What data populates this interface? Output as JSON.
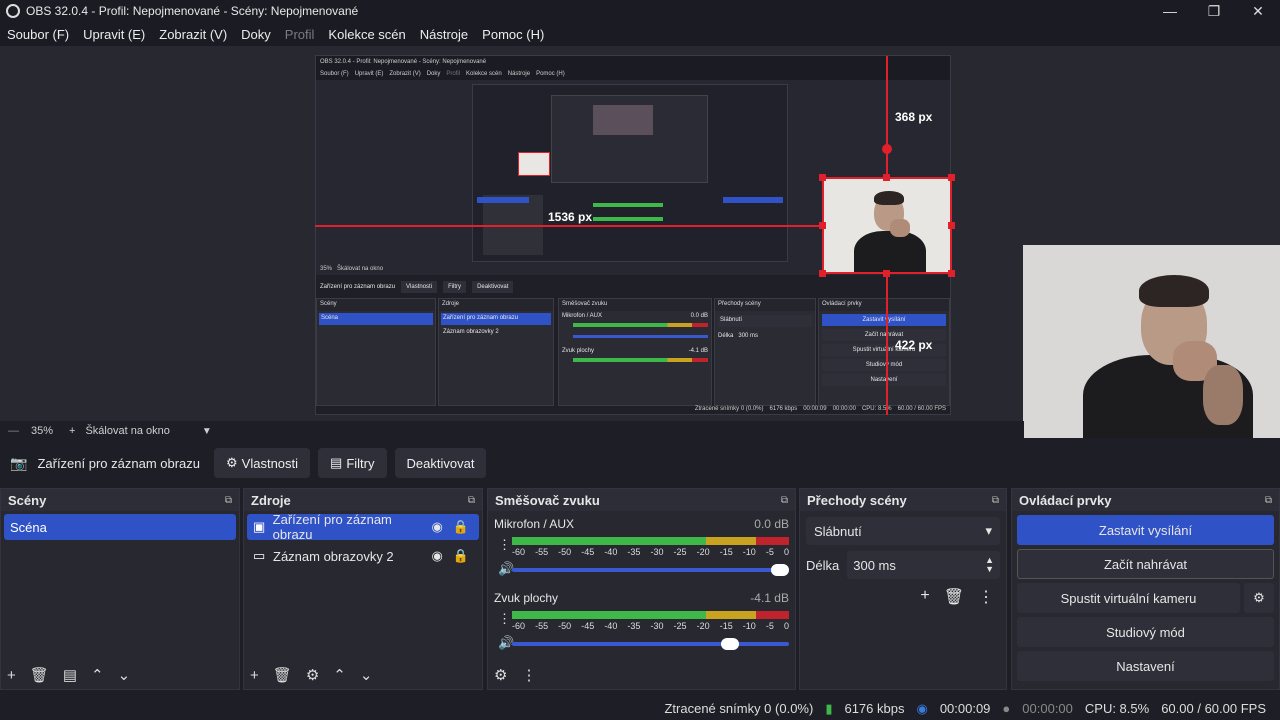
{
  "window": {
    "title": "OBS 32.0.4 - Profil: Nepojmenované - Scény: Nepojmenované",
    "minimize": "—",
    "maximize": "❐",
    "close": "✕"
  },
  "menu": {
    "soubor": "Soubor (F)",
    "upravit": "Upravit (E)",
    "zobrazit": "Zobrazit (V)",
    "doky": "Doky",
    "profil": "Profil",
    "kolekce": "Kolekce scén",
    "nastroje": "Nástroje",
    "pomoc": "Pomoc (H)"
  },
  "preview": {
    "measure_top": "368 px",
    "measure_left": "1536 px",
    "measure_bottom": "422 px",
    "nested_title": "OBS 32.0.4 - Profil: Nepojmenované - Scény: Nepojmenované",
    "nested_menu": [
      "Soubor (F)",
      "Upravit (E)",
      "Zobrazit (V)",
      "Doky",
      "Profil",
      "Kolekce scén",
      "Nástroje",
      "Pomoc (H)"
    ],
    "nested_zoom": "35%",
    "nested_scale": "Škálovat na okno",
    "nested_source": "Zařízení pro záznam obrazu",
    "nested_props": "Vlastnosti",
    "nested_filters": "Filtry",
    "nested_deact": "Deaktivovat",
    "nested_scenes_h": "Scény",
    "nested_scene": "Scéna",
    "nested_sources_h": "Zdroje",
    "nested_src1": "Zařízení pro záznam obrazu",
    "nested_src2": "Záznam obrazovky 2",
    "nested_mixer_h": "Směšovač zvuku",
    "nested_mic": "Mikrofon / AUX",
    "nested_mic_db": "0.0 dB",
    "nested_desk": "Zvuk plochy",
    "nested_desk_db": "-4.1 dB",
    "nested_trans_h": "Přechody scény",
    "nested_trans": "Slábnutí",
    "nested_len": "Délka",
    "nested_len_v": "300 ms",
    "nested_ctrl_h": "Ovládací prvky",
    "nested_c1": "Zastavit vysílání",
    "nested_c2": "Začít nahrávat",
    "nested_c3": "Spustit virtuální kameru",
    "nested_c4": "Studiový mód",
    "nested_c5": "Nastavení",
    "nested_status": "Ztracené snímky 0 (0.0%)",
    "nested_kbps": "6176 kbps",
    "nested_t1": "00:00:09",
    "nested_t2": "00:00:00",
    "nested_cpu": "CPU: 8.5%",
    "nested_fps": "60.00 / 60.00 FPS"
  },
  "zoom": {
    "minus": "—",
    "value": "35%",
    "plus": "+",
    "scale": "Škálovat na okno",
    "arrow": "▼"
  },
  "source_bar": {
    "source": "Zařízení pro záznam obrazu",
    "props": "Vlastnosti",
    "filters": "Filtry",
    "deactivate": "Deaktivovat"
  },
  "scenes": {
    "header": "Scény",
    "items": [
      "Scéna"
    ]
  },
  "sources": {
    "header": "Zdroje",
    "items": [
      "Zařízení pro záznam obrazu",
      "Záznam obrazovky 2"
    ]
  },
  "mixer": {
    "header": "Směšovač zvuku",
    "channels": [
      {
        "name": "Mikrofon / AUX",
        "db": "0.0 dB",
        "volume": 1.0
      },
      {
        "name": "Zvuk plochy",
        "db": "-4.1 dB",
        "volume": 0.82
      }
    ],
    "scale": [
      "-60",
      "-55",
      "-50",
      "-45",
      "-40",
      "-35",
      "-30",
      "-25",
      "-20",
      "-15",
      "-10",
      "-5",
      "0"
    ]
  },
  "transitions": {
    "header": "Přechody scény",
    "selected": "Slábnutí",
    "duration_label": "Délka",
    "duration": "300 ms"
  },
  "controls": {
    "header": "Ovládací prvky",
    "stop_stream": "Zastavit vysílání",
    "start_record": "Začít nahrávat",
    "virtual_cam": "Spustit virtuální kameru",
    "studio": "Studiový mód",
    "settings": "Nastavení"
  },
  "status": {
    "dropped": "Ztracené snímky 0 (0.0%)",
    "kbps": "6176 kbps",
    "live_time": "00:00:09",
    "rec_time": "00:00:00",
    "cpu": "CPU: 8.5%",
    "fps": "60.00 / 60.00 FPS"
  },
  "colors": {
    "accent": "#2f52c7",
    "red": "#e0202a",
    "meter_green": "#3fb84a",
    "meter_yellow": "#c9a21f",
    "meter_red": "#c0232b"
  }
}
